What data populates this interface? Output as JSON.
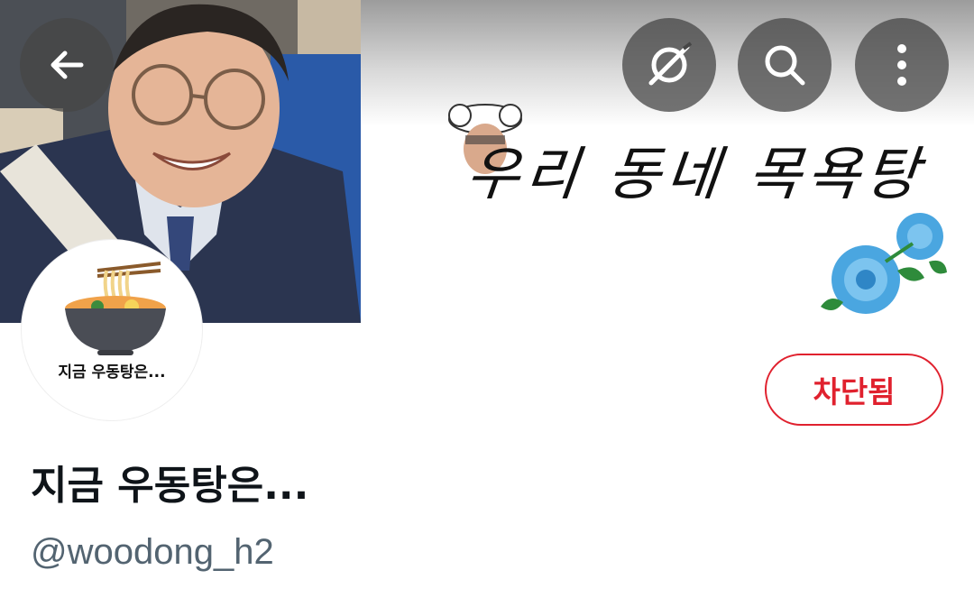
{
  "banner": {
    "title": "우리 동네 목욕탕"
  },
  "header": {
    "back_icon": "arrow-left-icon",
    "grok_icon": "grok-icon",
    "search_icon": "search-icon",
    "more_icon": "more-vertical-icon"
  },
  "profile": {
    "avatar_caption": "지금 우동탕은...",
    "display_name": "지금 우동탕은...",
    "handle": "@woodong_h2",
    "blocked_label": "차단됨"
  },
  "colors": {
    "blocked_red": "#e0212e",
    "handle_gray": "#536471",
    "header_button_bg": "#464646"
  }
}
